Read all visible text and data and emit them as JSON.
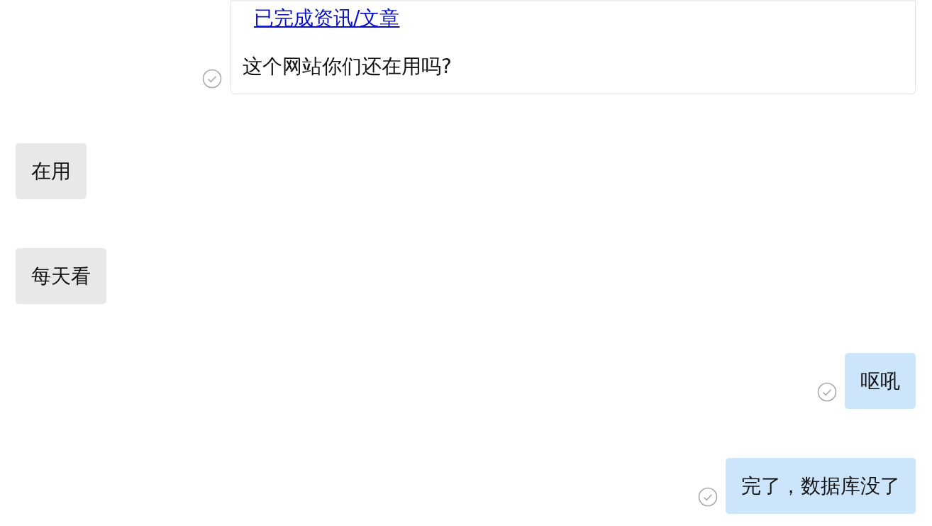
{
  "messages": [
    {
      "kind": "card",
      "read": true,
      "link": "已完成资讯/文章",
      "text": "这个网站你们还在用吗?"
    },
    {
      "kind": "bubble",
      "outgoing": false,
      "read": false,
      "text": "在用"
    },
    {
      "kind": "bubble",
      "outgoing": false,
      "read": false,
      "text": "每天看"
    },
    {
      "kind": "bubble",
      "outgoing": true,
      "read": true,
      "text": "呕吼"
    },
    {
      "kind": "bubble",
      "outgoing": true,
      "read": true,
      "text": "完了，数据库没了"
    }
  ]
}
